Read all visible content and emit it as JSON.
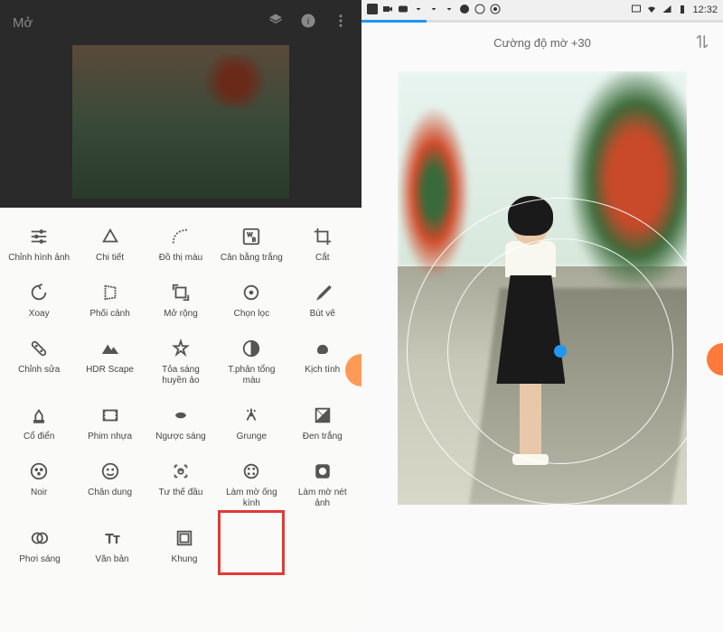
{
  "left": {
    "title": "Mở",
    "tools": [
      [
        {
          "n": "tune",
          "l": "Chỉnh hình ảnh"
        },
        {
          "n": "details",
          "l": "Chi tiết"
        },
        {
          "n": "curves",
          "l": "Đồ thị màu"
        },
        {
          "n": "wb",
          "l": "Cân bằng trắng"
        },
        {
          "n": "crop",
          "l": "Cắt"
        }
      ],
      [
        {
          "n": "rotate",
          "l": "Xoay"
        },
        {
          "n": "perspective",
          "l": "Phối cảnh"
        },
        {
          "n": "expand",
          "l": "Mở rộng"
        },
        {
          "n": "selective",
          "l": "Chọn lọc"
        },
        {
          "n": "brush",
          "l": "Bút vẽ"
        }
      ],
      [
        {
          "n": "healing",
          "l": "Chỉnh sửa"
        },
        {
          "n": "hdr",
          "l": "HDR Scape"
        },
        {
          "n": "glamour",
          "l": "Tỏa sáng huyền ảo"
        },
        {
          "n": "tonal",
          "l": "T.phản tổng màu"
        },
        {
          "n": "drama",
          "l": "Kịch tính"
        }
      ],
      [
        {
          "n": "vintage",
          "l": "Cổ điển"
        },
        {
          "n": "film",
          "l": "Phim nhựa"
        },
        {
          "n": "retrolux",
          "l": "Ngược sáng"
        },
        {
          "n": "grunge",
          "l": "Grunge"
        },
        {
          "n": "bw",
          "l": "Đen trắng"
        }
      ],
      [
        {
          "n": "noir",
          "l": "Noir"
        },
        {
          "n": "portrait",
          "l": "Chân dung"
        },
        {
          "n": "headpose",
          "l": "Tư thế đầu"
        },
        {
          "n": "lensblur",
          "l": "Làm mờ ống kính"
        },
        {
          "n": "vignette",
          "l": "Làm mờ nét ảnh"
        }
      ],
      [
        {
          "n": "doubleexp",
          "l": "Phơi sáng"
        },
        {
          "n": "text",
          "l": "Văn bản"
        },
        {
          "n": "frame",
          "l": "Khung"
        }
      ]
    ]
  },
  "right": {
    "statusbar": {
      "time": "12:32"
    },
    "slider_label": "Cường độ mờ +30"
  }
}
